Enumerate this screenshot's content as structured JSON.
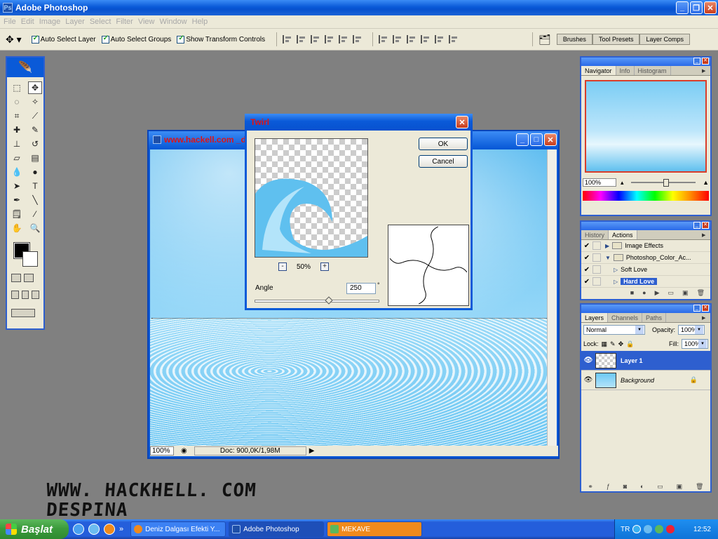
{
  "app": {
    "title": "Adobe Photoshop",
    "logo": "Ps"
  },
  "menu": [
    "File",
    "Edit",
    "Image",
    "Layer",
    "Select",
    "Filter",
    "View",
    "Window",
    "Help"
  ],
  "options": {
    "auto_select_layer": "Auto Select Layer",
    "auto_select_groups": "Auto Select Groups",
    "show_transform_controls": "Show Transform Controls",
    "well_tabs": [
      "Brushes",
      "Tool Presets",
      "Layer Comps"
    ]
  },
  "document": {
    "title": "www.hackell.com _d",
    "zoom": "100%",
    "doc_info": "Doc: 900,0K/1,98M"
  },
  "twirl": {
    "title": "Twirl",
    "ok": "OK",
    "cancel": "Cancel",
    "zoom": "50%",
    "zoom_out": "-",
    "zoom_in": "+",
    "angle_label": "Angle",
    "angle_value": "250",
    "degree_symbol": "°",
    "angle_slider_fraction": 0.6
  },
  "navigator": {
    "tabs": [
      "Navigator",
      "Info",
      "Histogram"
    ],
    "zoom": "100%"
  },
  "actions": {
    "tabs": [
      "History",
      "Actions"
    ],
    "rows": [
      {
        "label": "Image Effects",
        "type": "set"
      },
      {
        "label": "Photoshop_Color_Ac...",
        "type": "set-open"
      },
      {
        "label": "Soft Love",
        "type": "action"
      },
      {
        "label": "Hard Love",
        "type": "action",
        "selected": true
      }
    ]
  },
  "layers": {
    "tabs": [
      "Layers",
      "Channels",
      "Paths"
    ],
    "blend_mode": "Normal",
    "opacity_label": "Opacity:",
    "opacity": "100%",
    "lock_label": "Lock:",
    "fill_label": "Fill:",
    "fill": "100%",
    "rows": [
      {
        "name": "Layer 1",
        "selected": true
      },
      {
        "name": "Background",
        "selected": false
      }
    ]
  },
  "watermark": {
    "line1": "WWW. HACKHELL. COM",
    "line2": "DESPINA"
  },
  "taskbar": {
    "start": "Başlat",
    "tasks": [
      "Deniz Dalgası Efekti Y...",
      "Adobe Photoshop",
      "MEKAVE"
    ],
    "tray": {
      "lang": "TR",
      "time": "12:52"
    }
  },
  "colors": {
    "xp_blue": "#0a5ad8",
    "dialog_bg": "#ece9d8",
    "title_red": "#e01414"
  }
}
